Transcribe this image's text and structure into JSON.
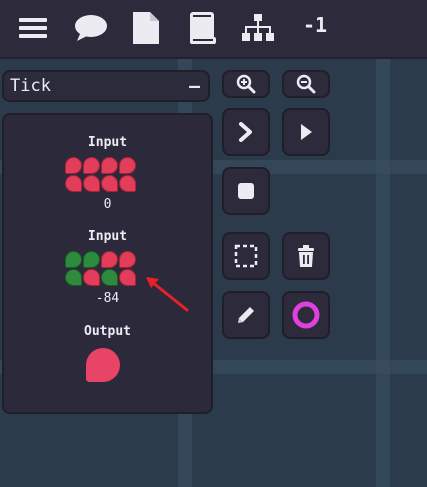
{
  "toolbar": {
    "items": [
      {
        "name": "menu-icon"
      },
      {
        "name": "chat-icon"
      },
      {
        "name": "document-icon"
      },
      {
        "name": "book-icon"
      },
      {
        "name": "hierarchy-icon"
      }
    ],
    "counter": "-1"
  },
  "dropdown": {
    "label": "Tick",
    "toggle": "–"
  },
  "panel": {
    "input1": {
      "title": "Input",
      "value": "0",
      "bits": [
        "red",
        "red",
        "red",
        "red",
        "red",
        "red",
        "red",
        "red"
      ]
    },
    "input2": {
      "title": "Input",
      "value": "-84",
      "bits": [
        "green",
        "green",
        "red",
        "red",
        "green",
        "red",
        "green",
        "red"
      ]
    },
    "output": {
      "title": "Output",
      "color": "#e84466"
    }
  },
  "colors": {
    "accent_pink": "#e84466",
    "bit_red": "#e23d5a",
    "bit_green": "#2e8b3e",
    "circle_magenta": "#e040e0",
    "annotation_arrow": "#e8202a"
  }
}
